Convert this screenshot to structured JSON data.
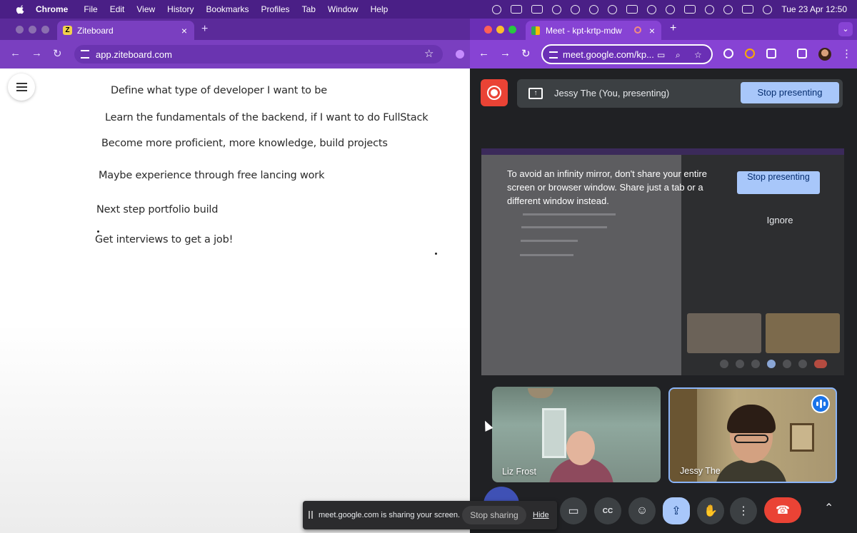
{
  "menubar": {
    "app_name": "Chrome",
    "items": [
      "File",
      "Edit",
      "View",
      "History",
      "Bookmarks",
      "Profiles",
      "Tab",
      "Window",
      "Help"
    ],
    "clock": "Tue 23 Apr  12:50"
  },
  "left_browser": {
    "tab_title": "Ziteboard",
    "tab_favicon": "Z",
    "url": "app.ziteboard.com",
    "colors": {
      "frame": "#5b2a9a",
      "toolbar": "#7a3fc0"
    }
  },
  "whiteboard": {
    "notes": [
      "Define what type of developer I want to be",
      "Learn the fundamentals of the backend, if I want to do FullStack",
      "Become more proficient, more knowledge, build projects",
      "Maybe experience through free lancing work",
      "Next step portfolio build",
      "Get interviews to get a job!"
    ]
  },
  "right_browser": {
    "tab_title": "Meet - kpt-krtp-mdw",
    "url": "meet.google.com/kp...",
    "colors": {
      "frame": "#6a2fb5",
      "toolbar": "#8743d4"
    }
  },
  "meet": {
    "presenting_label": "Jessy The (You, presenting)",
    "stop_presenting_label": "Stop presenting",
    "mirror_warning": "To avoid an infinity mirror, don't share your entire screen or browser window. Share just a tab or a different window instead.",
    "mirror_stop_label": "Stop presenting",
    "mirror_ignore_label": "Ignore",
    "participants": [
      {
        "name": "Liz Frost"
      },
      {
        "name": "Jessy The",
        "speaking": true
      }
    ],
    "colors": {
      "accent": "#a8c7fa",
      "danger": "#ea4335"
    }
  },
  "share_bar": {
    "message": "meet.google.com is sharing your screen.",
    "stop_label": "Stop sharing",
    "hide_label": "Hide"
  }
}
